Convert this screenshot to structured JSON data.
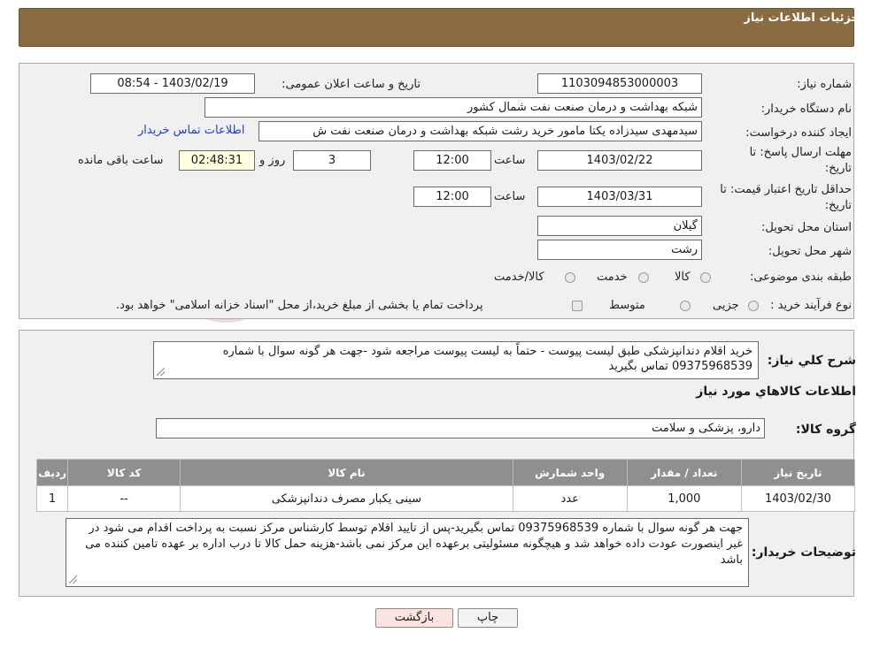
{
  "header": {
    "title": "جزئیات اطلاعات نیاز"
  },
  "watermark": {
    "text": "AriaTender.neT"
  },
  "form": {
    "need_number_label": "شماره نیاز:",
    "need_number": "1103094853000003",
    "announce_label": "تاریخ و ساعت اعلان عمومی:",
    "announce_value": "1403/02/19 - 08:54",
    "buyer_org_label": "نام دستگاه خریدار:",
    "buyer_org": "شبکه بهداشت و درمان صنعت نفت شمال کشور",
    "requester_label": "ایجاد کننده درخواست:",
    "requester": "سیدمهدی سیدزاده یکتا مامور خرید رشت شبکه بهداشت و درمان صنعت نفت ش",
    "contact_link": "اطلاعات تماس خریدار",
    "deadline_label_1": "مهلت ارسال پاسخ: تا",
    "deadline_label_2": "تاریخ:",
    "deadline_date": "1403/02/22",
    "time_label": "ساعت",
    "deadline_time": "12:00",
    "days_value": "3",
    "days_label": "روز و",
    "remaining_time": "02:48:31",
    "remaining_label": "ساعت باقی مانده",
    "validity_label_1": "حداقل تاریخ اعتبار قیمت: تا",
    "validity_label_2": "تاریخ:",
    "validity_date": "1403/03/31",
    "validity_time_label": "ساعت",
    "validity_time": "12:00",
    "province_label": "استان محل تحویل:",
    "province": "گیلان",
    "city_label": "شهر محل تحویل:",
    "city": "رشت",
    "category_label": "طبقه بندی موضوعی:",
    "category_options": [
      "کالا",
      "خدمت",
      "کالا/خدمت"
    ],
    "process_label": "نوع فرآیند خرید :",
    "process_options": [
      "جزیی",
      "متوسط"
    ],
    "process_note": "پرداخت تمام یا بخشی از مبلغ خرید،از محل \"اسناد خزانه اسلامی\" خواهد بود."
  },
  "details": {
    "summary_label": "شرح کلي نياز:",
    "summary_text": "خرید اقلام دندانپزشکی طبق لیست پیوست - حتماً به لیست پیوست مراجعه شود -جهت هر گونه سوال با شماره  09375968539 تماس بگیرید",
    "goods_info_title": "اطلاعات کالاهاي مورد نياز",
    "group_label": "گروه کالا:",
    "group_value": "دارو، پزشکی و سلامت",
    "table": {
      "headers": [
        "رديف",
        "کد کالا",
        "نام کالا",
        "واحد شمارش",
        "تعداد / مقدار",
        "تاريخ نياز"
      ],
      "rows": [
        [
          "1",
          "--",
          "سینی یکبار مصرف دندانپزشکی",
          "عدد",
          "1,000",
          "1403/02/30"
        ]
      ]
    },
    "buyer_notes_label": "توضيحات خريدار:",
    "buyer_notes": "جهت هر گونه سوال با شماره  09375968539 تماس بگیرید-پس از تایید اقلام توسط کارشناس مرکز نسبت به پرداخت اقدام می شود در غیر اینصورت عودت داده خواهد شد و هیچگونه مسئولیتی برعهده این مرکز نمی باشد-هزینه حمل کالا تا درب اداره بر عهده تامین کننده می باشد"
  },
  "buttons": {
    "print": "چاپ",
    "back": "بازگشت"
  },
  "colors": {
    "header": "#8b6b41",
    "table_header": "#8f8f8f",
    "link": "#1a3fd0",
    "back_button": "#fde2e2"
  }
}
